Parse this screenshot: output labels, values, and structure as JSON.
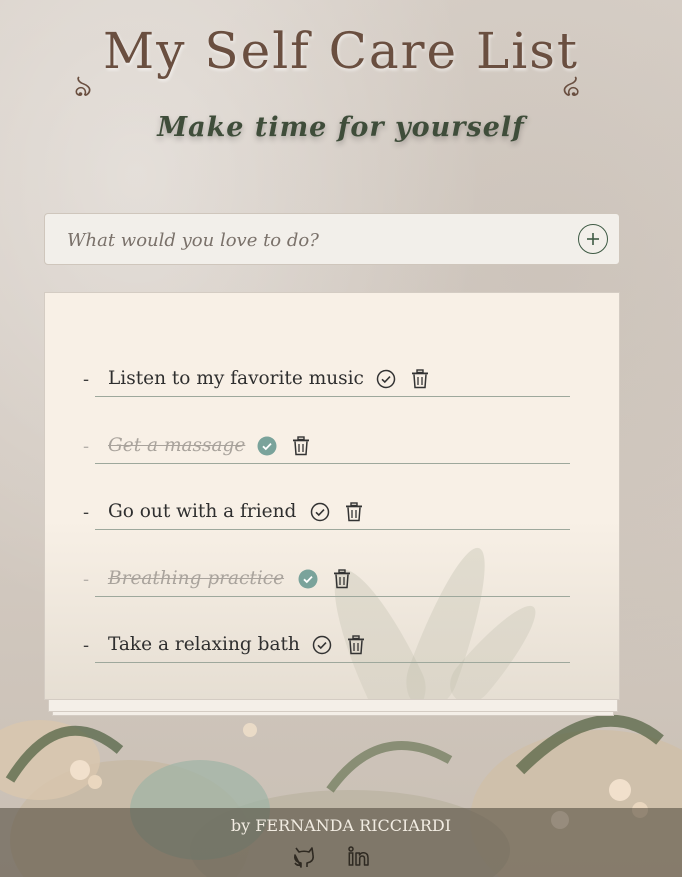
{
  "header": {
    "title": "My Self Care List",
    "subtitle": "Make time for yourself",
    "flourish_glyph": "ঌ"
  },
  "add_bar": {
    "placeholder": "What would you love to do?",
    "add_icon": "plus-circle-icon"
  },
  "todos": [
    {
      "text": "Listen to my favorite music",
      "done": false
    },
    {
      "text": "Get a massage",
      "done": true
    },
    {
      "text": "Go out with a friend",
      "done": false
    },
    {
      "text": "Breathing practice",
      "done": true
    },
    {
      "text": "Take a relaxing bath",
      "done": false
    }
  ],
  "footer": {
    "credit": "by FERNANDA RICCIARDI",
    "icons": [
      "github-icon",
      "linkedin-icon"
    ]
  },
  "colors": {
    "title": "#6a4f40",
    "subtitle": "#3f4d3a",
    "accent_green": "#3e5a44",
    "done_check": "#7aa39b",
    "card_bg": "#f8f0e6"
  }
}
